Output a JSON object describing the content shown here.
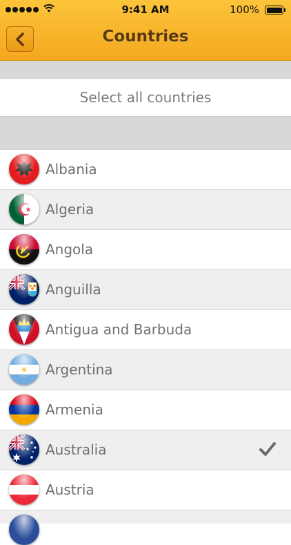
{
  "status_bar": {
    "time": "9:41 AM",
    "battery": "100%"
  },
  "header": {
    "title": "Countries",
    "back_icon": "chevron-left-icon"
  },
  "select_all_label": "Select all countries",
  "countries": [
    {
      "name": "Albania",
      "flag": "albania-flag-icon",
      "selected": false
    },
    {
      "name": "Algeria",
      "flag": "algeria-flag-icon",
      "selected": false
    },
    {
      "name": "Angola",
      "flag": "angola-flag-icon",
      "selected": false
    },
    {
      "name": "Anguilla",
      "flag": "anguilla-flag-icon",
      "selected": false
    },
    {
      "name": "Antigua and Barbuda",
      "flag": "antigua-and-barbuda-flag-icon",
      "selected": false
    },
    {
      "name": "Argentina",
      "flag": "argentina-flag-icon",
      "selected": false
    },
    {
      "name": "Armenia",
      "flag": "armenia-flag-icon",
      "selected": false
    },
    {
      "name": "Australia",
      "flag": "australia-flag-icon",
      "selected": true
    },
    {
      "name": "Austria",
      "flag": "austria-flag-icon",
      "selected": false
    }
  ],
  "colors": {
    "header": "#f4a81f",
    "title_text": "#5a3a0c",
    "row_alt": "#efefef",
    "spacer": "#d8d8d8"
  }
}
